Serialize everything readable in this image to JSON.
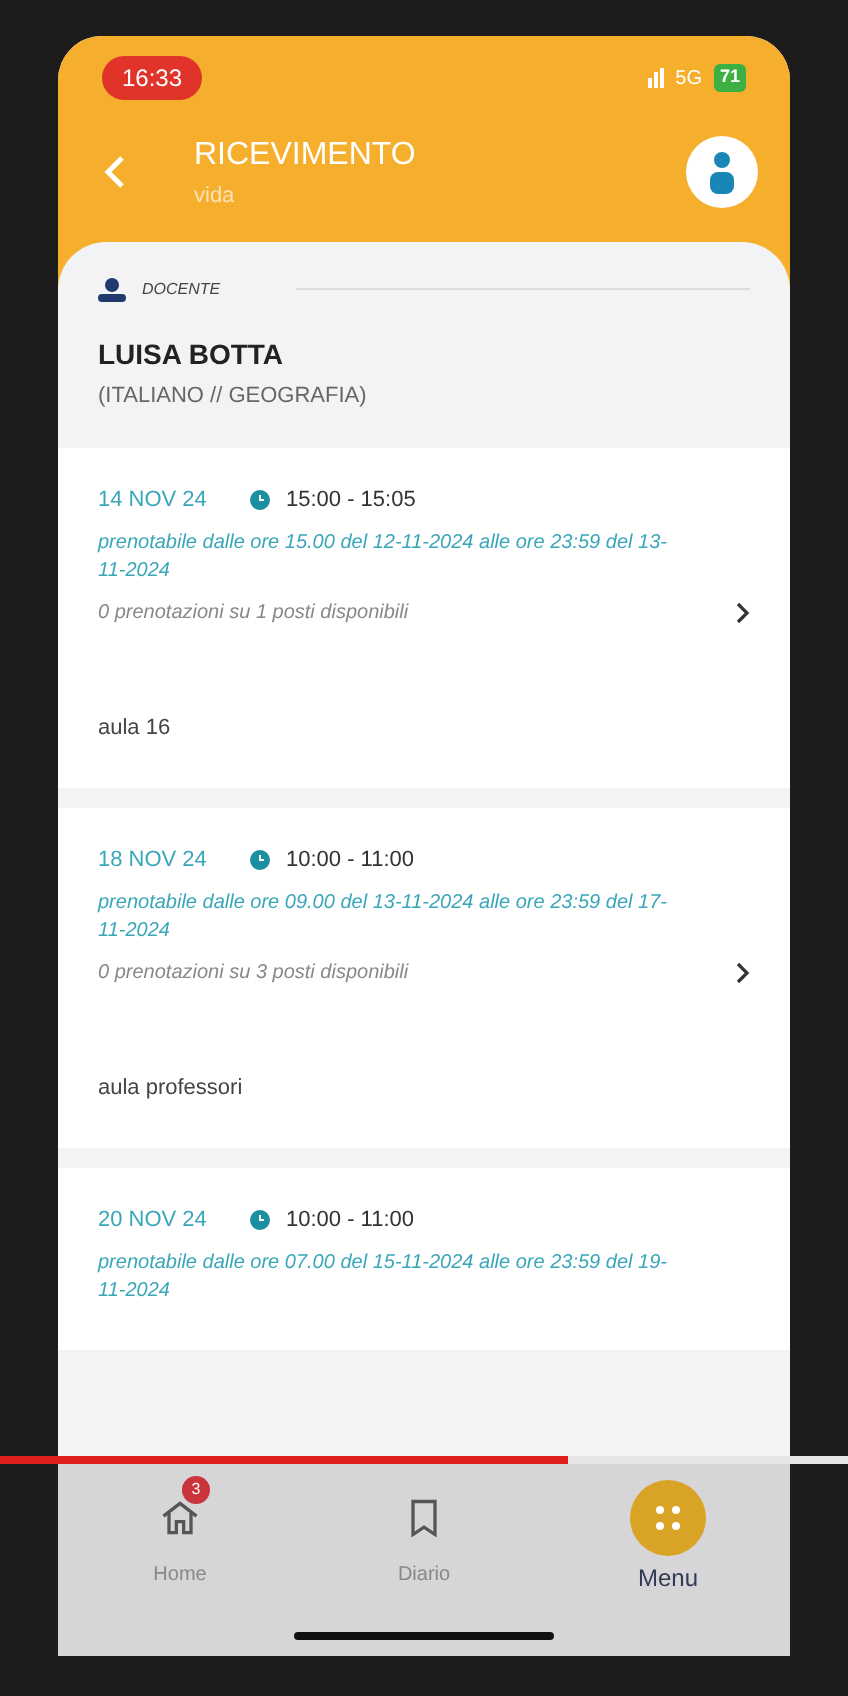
{
  "status_bar": {
    "time": "16:33",
    "network": "5G",
    "battery": "71"
  },
  "header": {
    "title": "RICEVIMENTO",
    "subtitle": "vida"
  },
  "teacher": {
    "label": "DOCENTE",
    "name": "LUISA BOTTA",
    "subjects": "(ITALIANO // GEOGRAFIA)"
  },
  "slots": [
    {
      "date": "14 NOV 24",
      "time": "15:00 - 15:05",
      "window": "prenotabile dalle ore 15.00 del 12-11-2024 alle ore 23:59 del 13-11-2024",
      "bookings": "0 prenotazioni su 1 posti disponibili",
      "room": "aula 16"
    },
    {
      "date": "18 NOV 24",
      "time": "10:00 - 11:00",
      "window": "prenotabile dalle ore 09.00 del 13-11-2024 alle ore 23:59 del 17-11-2024",
      "bookings": "0 prenotazioni su 3 posti disponibili",
      "room": "aula professori"
    },
    {
      "date": "20 NOV 24",
      "time": "10:00 - 11:00",
      "window": "prenotabile dalle ore 07.00 del 15-11-2024 alle ore 23:59 del 19-11-2024"
    }
  ],
  "nav": [
    {
      "label": "Home",
      "kind": "home",
      "badge": "3",
      "selected": false
    },
    {
      "label": "Diario",
      "kind": "diary",
      "selected": false
    },
    {
      "label": "Menu",
      "kind": "menu",
      "selected": true
    }
  ],
  "video": {
    "level": 0.67
  }
}
